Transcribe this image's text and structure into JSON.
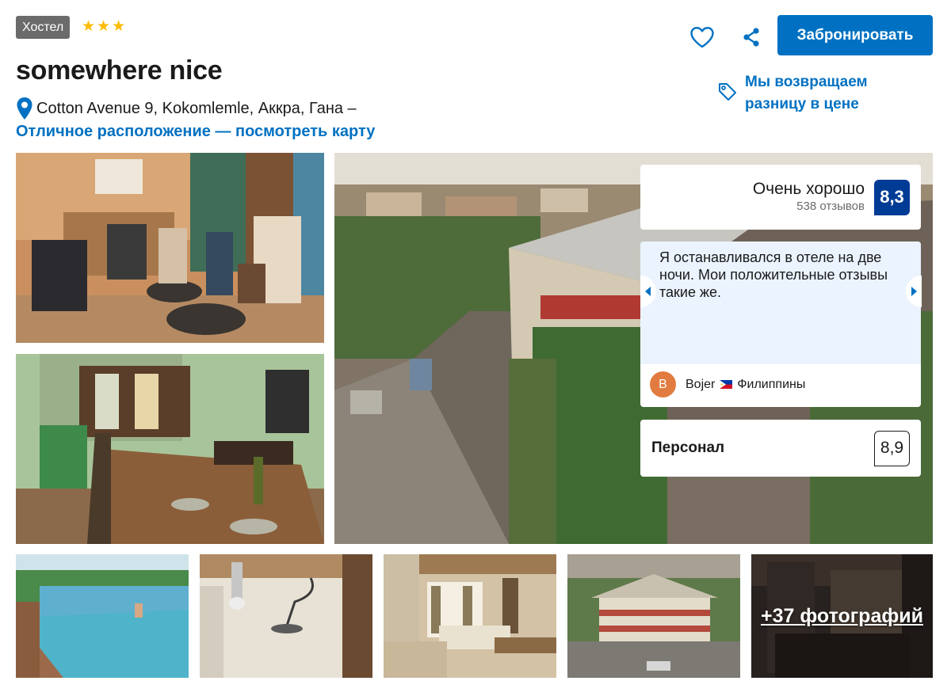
{
  "header": {
    "type_badge": "Хостел",
    "stars": [
      "★",
      "★",
      "★"
    ],
    "hotel_name": "somewhere nice",
    "address": "Cotton Avenue 9, Kokomlemle, Аккра, Гана –",
    "map_link": "Отличное расположение — посмотреть карту",
    "book_button": "Забронировать",
    "price_match": "Мы возвращаем разницу в цене",
    "icons": [
      "map-pin-icon",
      "heart-icon",
      "share-icon",
      "price-tag-icon"
    ]
  },
  "rating": {
    "label": "Очень хорошо",
    "count": "538 отзывов",
    "score": "8,3"
  },
  "review": {
    "text": "Я останавливался в отеле на две ночи. Мои положительные отзывы такие же.",
    "avatar_letter": "B",
    "name": "Bojer",
    "country": "Филиппины"
  },
  "staff": {
    "label": "Персонал",
    "score": "8,9"
  },
  "gallery": {
    "more_photos": "+37 фотографий"
  },
  "colors": {
    "brand_blue": "#0071c2",
    "score_dark_blue": "#003b95",
    "star_yellow": "#febb02",
    "review_bg": "#ebf3ff",
    "badge_gray": "#6b6b6b"
  }
}
